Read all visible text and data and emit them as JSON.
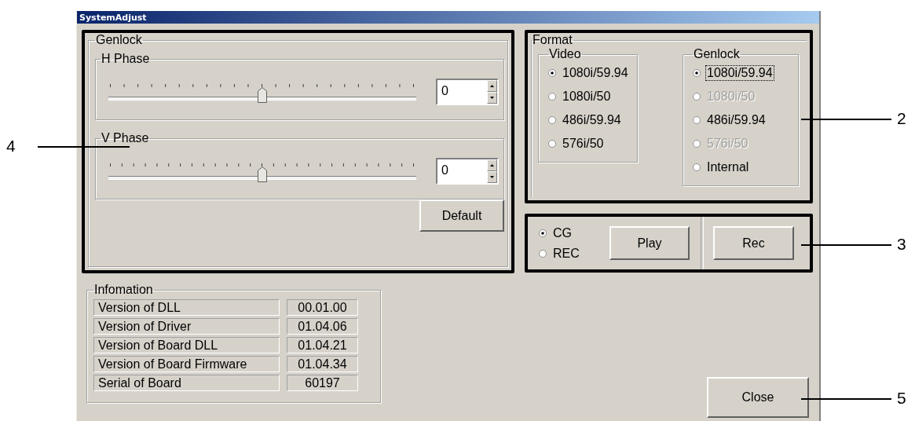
{
  "window": {
    "title": "SystemAdjust"
  },
  "genlock": {
    "title": "Genlock",
    "sliders": [
      {
        "title": "H Phase",
        "level": 0.5,
        "value": "0"
      },
      {
        "title": "V Phase",
        "level": 0.5,
        "value": "0"
      }
    ],
    "default_button": "Default"
  },
  "information": {
    "title": "Infomation",
    "rows": [
      {
        "label": "Version of DLL",
        "value": "00.01.00"
      },
      {
        "label": "Version of Driver",
        "value": "01.04.06"
      },
      {
        "label": "Version of Board DLL",
        "value": "01.04.21"
      },
      {
        "label": "Version of Board Firmware",
        "value": "01.04.34"
      },
      {
        "label": "Serial of Board",
        "value": "60197"
      }
    ]
  },
  "format": {
    "title": "Format",
    "groups": [
      {
        "title": "Video",
        "options": [
          {
            "label": "1080i/59.94",
            "selected": true,
            "disabled": false,
            "focused": false
          },
          {
            "label": "1080i/50",
            "selected": false,
            "disabled": false,
            "focused": false
          },
          {
            "label": "486i/59.94",
            "selected": false,
            "disabled": false,
            "focused": false
          },
          {
            "label": "576i/50",
            "selected": false,
            "disabled": false,
            "focused": false
          }
        ]
      },
      {
        "title": "Genlock",
        "options": [
          {
            "label": "1080i/59.94",
            "selected": true,
            "disabled": false,
            "focused": true
          },
          {
            "label": "1080i/50",
            "selected": false,
            "disabled": true,
            "focused": false
          },
          {
            "label": "486i/59.94",
            "selected": false,
            "disabled": false,
            "focused": false
          },
          {
            "label": "576i/50",
            "selected": false,
            "disabled": true,
            "focused": false
          },
          {
            "label": "Internal",
            "selected": false,
            "disabled": false,
            "focused": false
          }
        ]
      }
    ]
  },
  "record": {
    "sources": [
      {
        "label": "CG",
        "selected": true
      },
      {
        "label": "REC",
        "selected": false
      }
    ],
    "play_button": "Play",
    "rec_button": "Rec"
  },
  "close_button": "Close",
  "callouts": [
    {
      "label": "4"
    },
    {
      "label": "2"
    },
    {
      "label": "3"
    },
    {
      "label": "5"
    }
  ]
}
